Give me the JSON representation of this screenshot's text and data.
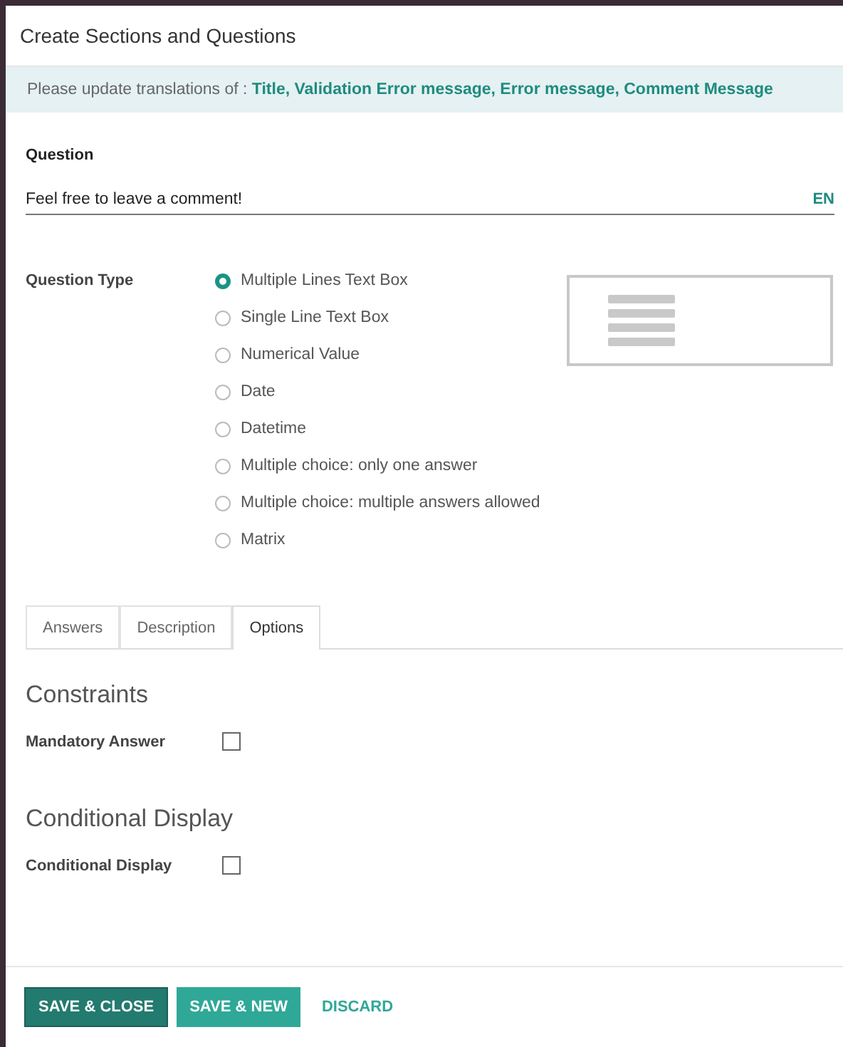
{
  "dialog": {
    "title": "Create Sections and Questions"
  },
  "alert": {
    "text": "Please update translations of : ",
    "fields": "Title, Validation Error message, Error message, Comment Message"
  },
  "question": {
    "label": "Question",
    "value": "Feel free to leave a comment!",
    "language": "EN"
  },
  "question_type": {
    "label": "Question Type",
    "options": [
      {
        "label": "Multiple Lines Text Box",
        "selected": true
      },
      {
        "label": "Single Line Text Box",
        "selected": false
      },
      {
        "label": "Numerical Value",
        "selected": false
      },
      {
        "label": "Date",
        "selected": false
      },
      {
        "label": "Datetime",
        "selected": false
      },
      {
        "label": "Multiple choice: only one answer",
        "selected": false
      },
      {
        "label": "Multiple choice: multiple answers allowed",
        "selected": false
      },
      {
        "label": "Matrix",
        "selected": false
      }
    ]
  },
  "tabs": [
    {
      "label": "Answers",
      "selected": false
    },
    {
      "label": "Description",
      "selected": false
    },
    {
      "label": "Options",
      "selected": true
    }
  ],
  "sections": [
    {
      "title": "Constraints",
      "fields": [
        {
          "label": "Mandatory Answer",
          "checked": false
        }
      ]
    },
    {
      "title": "Conditional Display",
      "fields": [
        {
          "label": "Conditional Display",
          "checked": false
        }
      ]
    }
  ],
  "buttons": [
    {
      "label": "SAVE & CLOSE",
      "kind": "primary"
    },
    {
      "label": "SAVE & NEW",
      "kind": "secondary"
    },
    {
      "label": "DISCARD",
      "kind": "link"
    }
  ]
}
